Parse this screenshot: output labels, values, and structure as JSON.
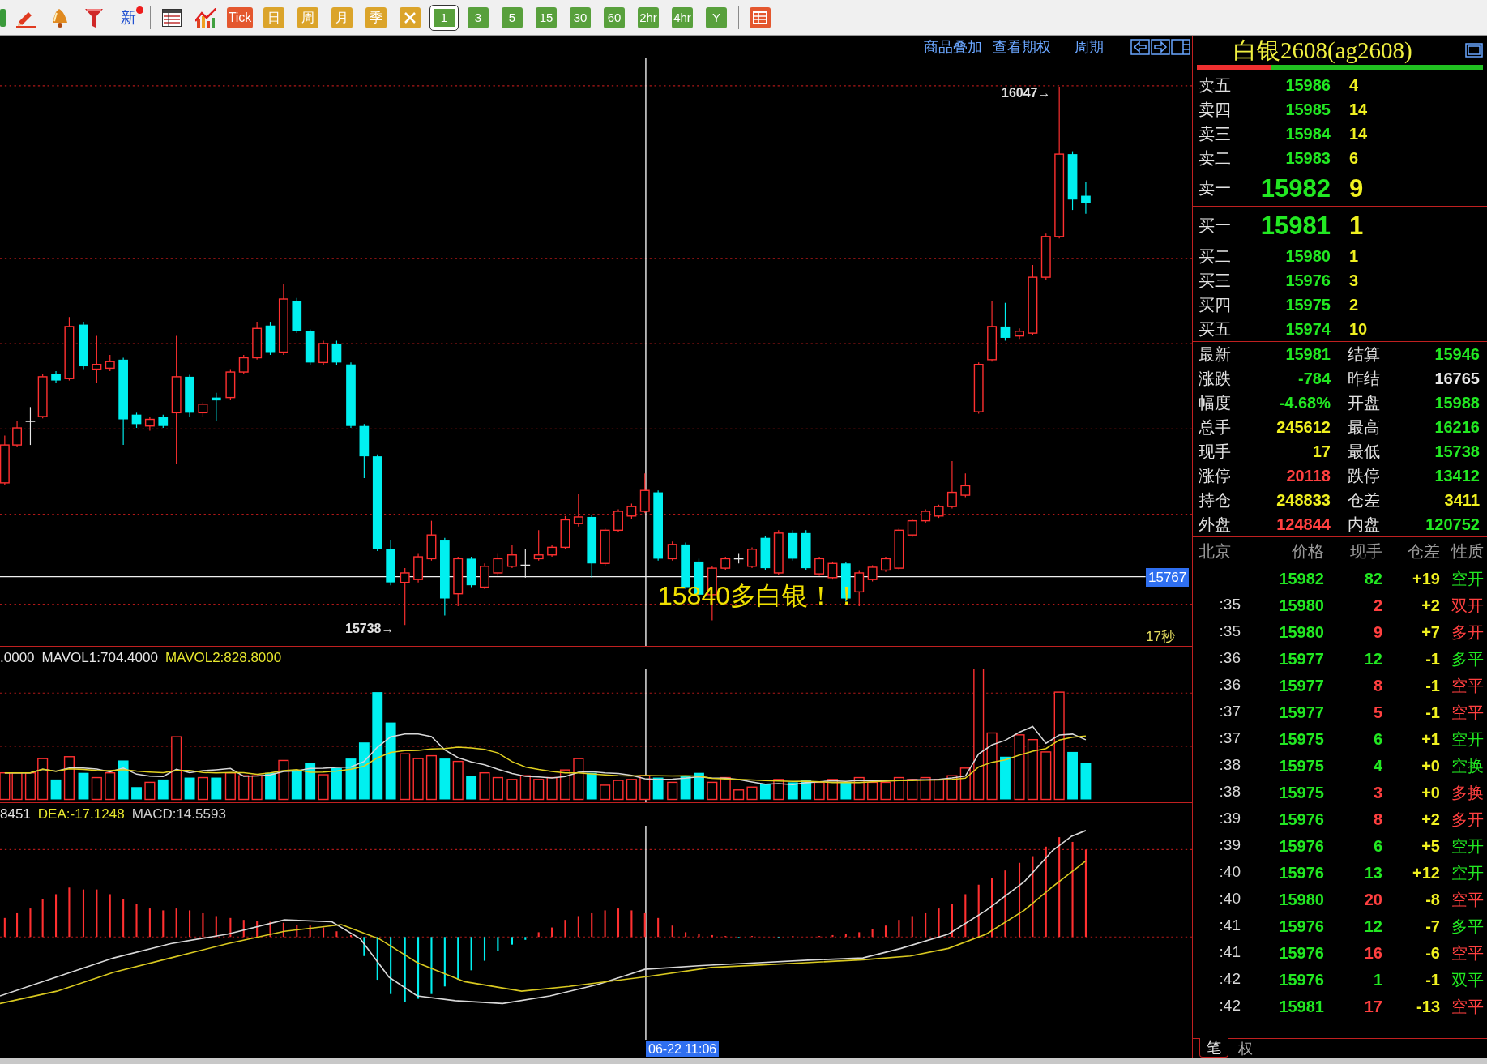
{
  "toolbar": {
    "new_label": "新",
    "chart_buttons": [
      {
        "label": "Tick",
        "color": "#e4572e"
      },
      {
        "label": "日",
        "color": "#dba42a"
      },
      {
        "label": "周",
        "color": "#dba42a"
      },
      {
        "label": "月",
        "color": "#dba42a"
      },
      {
        "label": "季",
        "color": "#dba42a"
      }
    ],
    "periods": [
      {
        "label": "1",
        "selected": true
      },
      {
        "label": "3",
        "selected": false
      },
      {
        "label": "5",
        "selected": false
      },
      {
        "label": "15",
        "selected": false
      },
      {
        "label": "30",
        "selected": false
      },
      {
        "label": "60",
        "selected": false
      },
      {
        "label": "2hr",
        "selected": false
      },
      {
        "label": "4hr",
        "selected": false
      },
      {
        "label": "Y",
        "selected": false
      }
    ]
  },
  "chart_links": [
    "商品叠加",
    "查看期权",
    "周期"
  ],
  "price_chart": {
    "high_label": "16047→",
    "low_label": "15738→",
    "crosshair_price": "15767",
    "countdown": "17秒",
    "annotation": "15840多白银！！"
  },
  "volume_chart": {
    "legend": [
      {
        "text": ".0000",
        "color": "#e6e6e6"
      },
      {
        "text": "MAVOL1:704.4000",
        "color": "#e6e6e6"
      },
      {
        "text": "MAVOL2:828.8000",
        "color": "#e6e62e"
      }
    ]
  },
  "macd_chart": {
    "legend": [
      {
        "text": "8451",
        "color": "#e6e6e6"
      },
      {
        "text": "DEA:-17.1248",
        "color": "#e6e62e"
      },
      {
        "text": "MACD:14.5593",
        "color": "#d0d0d0"
      }
    ]
  },
  "crosshair_time": "06-22 11:06",
  "quote_panel": {
    "title": "白银2608(ag2608)",
    "ratio_bar": {
      "level": 0.26
    },
    "asks": [
      {
        "label": "卖五",
        "price": "15986",
        "volume": "4"
      },
      {
        "label": "卖四",
        "price": "15985",
        "volume": "14"
      },
      {
        "label": "卖三",
        "price": "15984",
        "volume": "14"
      },
      {
        "label": "卖二",
        "price": "15983",
        "volume": "6"
      }
    ],
    "best_ask": {
      "label": "卖一",
      "price": "15982",
      "volume": "9"
    },
    "best_bid": {
      "label": "买一",
      "price": "15981",
      "volume": "1"
    },
    "bids": [
      {
        "label": "买二",
        "price": "15980",
        "volume": "1"
      },
      {
        "label": "买三",
        "price": "15976",
        "volume": "3"
      },
      {
        "label": "买四",
        "price": "15975",
        "volume": "2"
      },
      {
        "label": "买五",
        "price": "15974",
        "volume": "10"
      }
    ],
    "stats_rows": [
      [
        {
          "label": "最新",
          "value": "15981",
          "color": "#22e822"
        },
        {
          "label": "结算",
          "value": "15946",
          "color": "#22e822"
        }
      ],
      [
        {
          "label": "涨跌",
          "value": "-784",
          "color": "#22e822"
        },
        {
          "label": "昨结",
          "value": "16765",
          "color": "#e8e8e8"
        }
      ],
      [
        {
          "label": "幅度",
          "value": "-4.68%",
          "color": "#22e822"
        },
        {
          "label": "开盘",
          "value": "15988",
          "color": "#22e822"
        }
      ],
      [
        {
          "label": "总手",
          "value": "245612",
          "color": "#f0f020"
        },
        {
          "label": "最高",
          "value": "16216",
          "color": "#22e822"
        }
      ],
      [
        {
          "label": "现手",
          "value": "17",
          "color": "#f0f020"
        },
        {
          "label": "最低",
          "value": "15738",
          "color": "#22e822"
        }
      ],
      [
        {
          "label": "涨停",
          "value": "20118",
          "color": "#ff4040"
        },
        {
          "label": "跌停",
          "value": "13412",
          "color": "#22e822"
        }
      ],
      [
        {
          "label": "持仓",
          "value": "248833",
          "color": "#f0f020"
        },
        {
          "label": "仓差",
          "value": "3411",
          "color": "#f0f020"
        }
      ],
      [
        {
          "label": "外盘",
          "value": "124844",
          "color": "#ff4040"
        },
        {
          "label": "内盘",
          "value": "120752",
          "color": "#22e822"
        }
      ]
    ],
    "ticks": {
      "columns": [
        "北京",
        "价格",
        "现手",
        "仓差",
        "性质"
      ],
      "rows": [
        {
          "price": "15982",
          "volume": "82",
          "oi_change": "+19",
          "nature": "空开",
          "color": "#22e822"
        },
        {
          "time": ":35",
          "price": "15980",
          "volume": "2",
          "oi_change": "+2",
          "nature": "双开",
          "color": "#ff4040"
        },
        {
          "time": ":35",
          "price": "15980",
          "volume": "9",
          "oi_change": "+7",
          "nature": "多开",
          "color": "#ff4040"
        },
        {
          "time": ":36",
          "price": "15977",
          "volume": "12",
          "oi_change": "-1",
          "nature": "多平",
          "color": "#22e822"
        },
        {
          "time": ":36",
          "price": "15977",
          "volume": "8",
          "oi_change": "-1",
          "nature": "空平",
          "color": "#ff4040"
        },
        {
          "time": ":37",
          "price": "15977",
          "volume": "5",
          "oi_change": "-1",
          "nature": "空平",
          "color": "#ff4040"
        },
        {
          "time": ":37",
          "price": "15975",
          "volume": "6",
          "oi_change": "+1",
          "nature": "空开",
          "color": "#22e822"
        },
        {
          "time": ":38",
          "price": "15975",
          "volume": "4",
          "oi_change": "+0",
          "nature": "空换",
          "color": "#22e822"
        },
        {
          "time": ":38",
          "price": "15975",
          "volume": "3",
          "oi_change": "+0",
          "nature": "多换",
          "color": "#ff4040"
        },
        {
          "time": ":39",
          "price": "15976",
          "volume": "8",
          "oi_change": "+2",
          "nature": "多开",
          "color": "#ff4040"
        },
        {
          "time": ":39",
          "price": "15976",
          "volume": "6",
          "oi_change": "+5",
          "nature": "空开",
          "color": "#22e822"
        },
        {
          "time": ":40",
          "price": "15976",
          "volume": "13",
          "oi_change": "+12",
          "nature": "空开",
          "color": "#22e822"
        },
        {
          "time": ":40",
          "price": "15980",
          "volume": "20",
          "oi_change": "-8",
          "nature": "空平",
          "color": "#ff4040"
        },
        {
          "time": ":41",
          "price": "15976",
          "volume": "12",
          "oi_change": "-7",
          "nature": "多平",
          "color": "#22e822"
        },
        {
          "time": ":41",
          "price": "15976",
          "volume": "16",
          "oi_change": "-6",
          "nature": "空平",
          "color": "#ff4040"
        },
        {
          "time": ":42",
          "price": "15976",
          "volume": "1",
          "oi_change": "-1",
          "nature": "双平",
          "color": "#22e822"
        },
        {
          "time": ":42",
          "price": "15981",
          "volume": "17",
          "oi_change": "-13",
          "nature": "空平",
          "color": "#ff4040"
        }
      ]
    },
    "tabs": [
      {
        "label": "笔",
        "selected": true
      },
      {
        "label": "权",
        "selected": false
      }
    ]
  }
}
